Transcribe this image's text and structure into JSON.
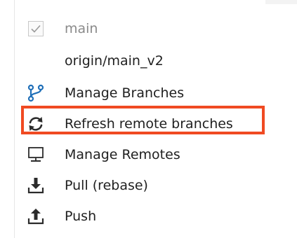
{
  "menu": {
    "items": [
      {
        "label": "main",
        "icon": "checkmark-icon",
        "checked": true,
        "disabled": true
      },
      {
        "label": "origin/main_v2",
        "icon": "",
        "checked": false,
        "disabled": false
      },
      {
        "label": "Manage Branches",
        "icon": "branch-icon",
        "disabled": false
      },
      {
        "label": "Refresh remote branches",
        "icon": "refresh-icon",
        "disabled": false,
        "highlighted": true
      },
      {
        "label": "Manage Remotes",
        "icon": "monitor-icon",
        "disabled": false
      },
      {
        "label": "Pull (rebase)",
        "icon": "download-tray-icon",
        "disabled": false
      },
      {
        "label": "Push",
        "icon": "upload-tray-icon",
        "disabled": false
      }
    ]
  },
  "colors": {
    "branch_icon": "#1f6fb8",
    "icon_dark": "#2b2b2b",
    "highlight_border": "#f04a22",
    "disabled_text": "#8a8a8a"
  }
}
